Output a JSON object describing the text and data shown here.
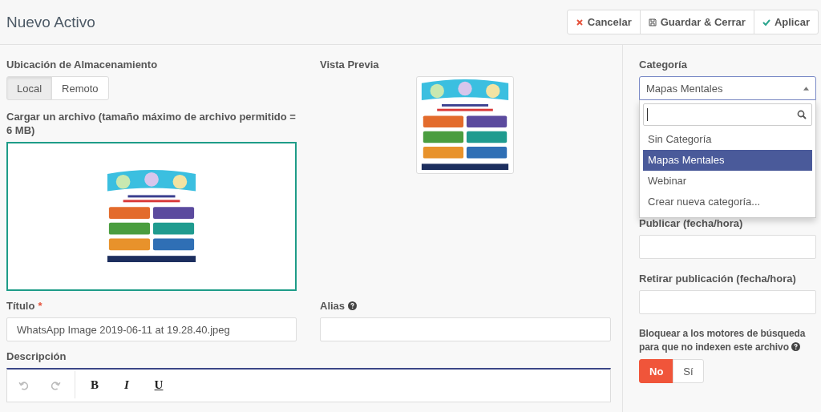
{
  "header": {
    "title": "Nuevo Activo",
    "buttons": [
      {
        "label": "Cancelar",
        "kind": "cancel"
      },
      {
        "label": "Guardar & Cerrar",
        "kind": "save"
      },
      {
        "label": "Aplicar",
        "kind": "apply"
      }
    ]
  },
  "storage": {
    "label": "Ubicación de Almacenamiento",
    "options": [
      {
        "label": "Local",
        "selected": true
      },
      {
        "label": "Remoto",
        "selected": false
      }
    ]
  },
  "upload": {
    "label": "Cargar un archivo (tamaño máximo de archivo permitido = 6 MB)"
  },
  "preview": {
    "label": "Vista Previa"
  },
  "title_field": {
    "label": "Título",
    "required_mark": "*",
    "value": "WhatsApp Image 2019-06-11 at 19.28.40.jpeg"
  },
  "alias": {
    "label": "Alias",
    "help": true
  },
  "description": {
    "label": "Descripción",
    "toolbar": [
      {
        "kind": "undo",
        "disabled": true
      },
      {
        "kind": "redo",
        "disabled": true
      },
      {
        "kind": "bold",
        "label": "B"
      },
      {
        "kind": "italic",
        "label": "I"
      },
      {
        "kind": "underline",
        "label": "U"
      }
    ]
  },
  "category": {
    "label": "Categoría",
    "value": "Mapas Mentales",
    "expanded": true,
    "options": [
      {
        "label": "Sin Categoría",
        "selected": false
      },
      {
        "label": "Mapas Mentales",
        "selected": true
      },
      {
        "label": "Webinar",
        "selected": false
      },
      {
        "label": "Crear nueva categoría...",
        "selected": false
      }
    ]
  },
  "publish_up": {
    "label": "Publicar (fecha/hora)"
  },
  "publish_down": {
    "label": "Retirar publicación (fecha/hora)"
  },
  "block_search": {
    "label": "Bloquear a los motores de búsqueda para que no indexen este archivo",
    "help": true,
    "options": [
      {
        "label": "No",
        "selected": true
      },
      {
        "label": "Sí",
        "selected": false
      }
    ]
  }
}
